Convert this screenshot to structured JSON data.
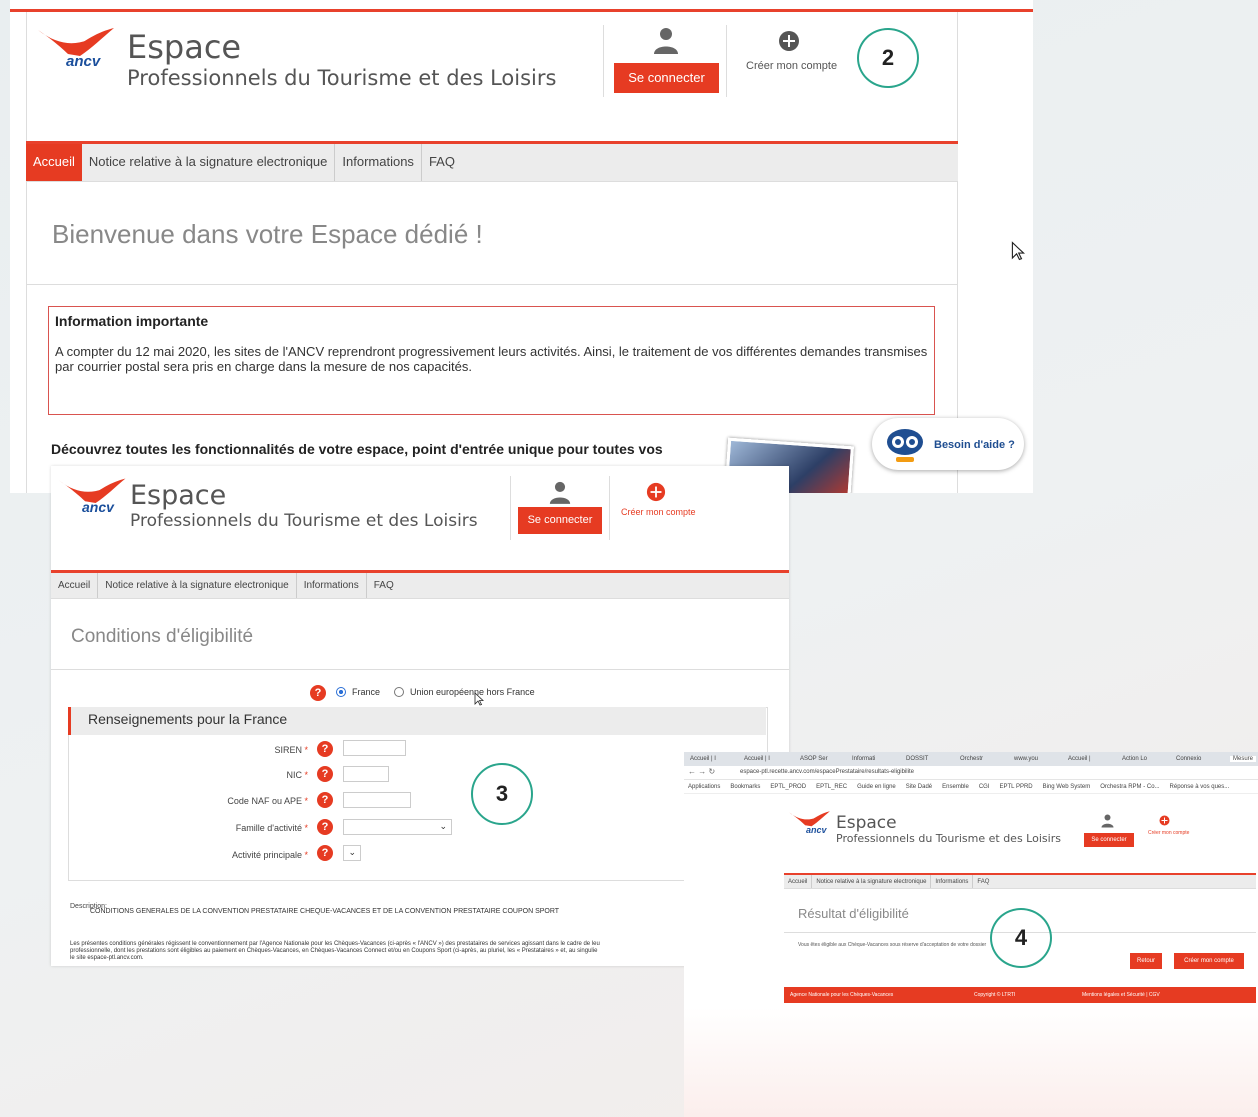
{
  "shot1": {
    "brand_small": "ancv",
    "brand_title": "Espace",
    "brand_subtitle": "Professionnels du Tourisme et des Loisirs",
    "login_button": "Se connecter",
    "create_account": "Créer mon compte",
    "step": "2",
    "nav": [
      "Accueil",
      "Notice relative à la signature electronique",
      "Informations",
      "FAQ"
    ],
    "page_title": "Bienvenue dans votre Espace dédié !",
    "info_title": "Information importante",
    "info_text": "A compter du 12 mai 2020, les sites de l'ANCV reprendront progressivement leurs activités. Ainsi, le traitement de vos différentes demandes transmises par courrier postal sera pris en charge dans la mesure de nos capacités.",
    "discover_text": "Découvrez toutes les fonctionnalités de votre espace, point d'entrée unique pour toutes vos",
    "help_button": "Besoin d'aide ?"
  },
  "shot2": {
    "brand_small": "ancv",
    "brand_title": "Espace",
    "brand_subtitle": "Professionnels du Tourisme et des Loisirs",
    "login_button": "Se connecter",
    "create_account": "Créer mon compte",
    "nav": [
      "Accueil",
      "Notice relative à la signature electronique",
      "Informations",
      "FAQ"
    ],
    "page_title": "Conditions d'éligibilité",
    "radio_france": "France",
    "radio_ue": "Union européenne hors France",
    "section_title": "Renseignements pour la France",
    "fields": [
      {
        "label": "SIREN",
        "req": "*"
      },
      {
        "label": "NIC",
        "req": "*"
      },
      {
        "label": "Code NAF ou APE",
        "req": "*"
      },
      {
        "label": "Famille d'activité",
        "req": "*"
      },
      {
        "label": "Activité principale",
        "req": "*"
      }
    ],
    "step": "3",
    "description_label": "Description:",
    "description_title": "CONDITIONS GENERALES DE LA CONVENTION PRESTATAIRE CHEQUE-VACANCES ET DE LA CONVENTION PRESTATAIRE COUPON SPORT",
    "conditions_text": [
      "Les présentes conditions générales régissent le conventionnement par l'Agence Nationale pour les Chèques-Vacances (ci-après « l'ANCV ») des prestataires de services agissant dans le cadre de leu",
      "professionnelle, dont les prestations sont éligibles au paiement en Chèques-Vacances, en Chèques-Vacances Connect et/ou en Coupons Sport (ci-après, au pluriel, les « Prestataires » et, au singulie",
      "le site espace-ptl.ancv.com."
    ]
  },
  "shot3": {
    "tabs": [
      "Accueil | I",
      "Accueil | I",
      "ASOP Ser",
      "Informati",
      "DOSSIT",
      "Orchestr",
      "www.you",
      "Accueil |",
      "Action Lo",
      "Connexio",
      "Mesure"
    ],
    "url": "espace-ptl.recette.ancv.com/espacePrestataire/resultats-eligibilite",
    "bookmarks": [
      "Applications",
      "Bookmarks",
      "EPTL_PROD",
      "EPTL_REC",
      "Guide en ligne",
      "Site Dadé",
      "Ensemble",
      "CGI",
      "EPTL PPRD",
      "Bing Web System",
      "Orchestra RPM - Co...",
      "Réponse à vos ques..."
    ],
    "brand_small": "ancv",
    "brand_title": "Espace",
    "brand_subtitle": "Professionnels du Tourisme et des Loisirs",
    "login_button": "Se connecter",
    "create_account": "Créer mon compte",
    "nav": [
      "Accueil",
      "Notice relative à la signature electronique",
      "Informations",
      "FAQ"
    ],
    "page_title": "Résultat d'éligibilité",
    "result_text": "Vous êtes éligible aux Chèque-Vacances sous réserve d'acceptation de votre dossier",
    "back_button": "Retour",
    "create_button": "Créer mon compte",
    "footer_left": "Agence Nationale pour les Chèques-Vacances",
    "footer_mid": "Copyright © LTRTI",
    "footer_right": "Mentions légales et Sécurité | CGV",
    "step": "4"
  },
  "colors": {
    "accent": "#e63b22",
    "step_ring": "#2aa58c"
  }
}
